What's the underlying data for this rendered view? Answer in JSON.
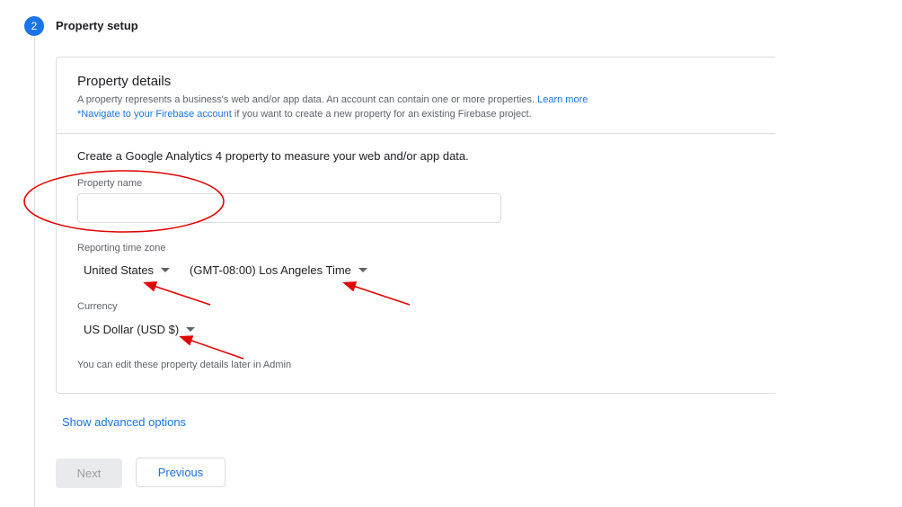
{
  "stepper": {
    "number": "2",
    "title": "Property setup"
  },
  "property_details": {
    "title": "Property details",
    "description": "A property represents a business's web and/or app data. An account can contain one or more properties.",
    "learn_more": "Learn more",
    "firebase_link": "*Navigate to your Firebase account",
    "firebase_rest": "if you want to create a new property for an existing Firebase project."
  },
  "form": {
    "intro": "Create a Google Analytics 4 property to measure your web and/or app data.",
    "property_name": {
      "label": "Property name",
      "value": "",
      "placeholder": ""
    },
    "time_zone": {
      "label": "Reporting time zone",
      "country": "United States",
      "zone": "(GMT-08:00) Los Angeles Time"
    },
    "currency": {
      "label": "Currency",
      "value": "US Dollar (USD $)"
    },
    "note": "You can edit these property details later in Admin"
  },
  "advanced_options": "Show advanced options",
  "buttons": {
    "next": "Next",
    "previous": "Previous"
  },
  "colors": {
    "accent": "#1a73e8",
    "annotation": "#e00000",
    "border": "#dadce0",
    "disabled_bg": "#e8eaed"
  }
}
